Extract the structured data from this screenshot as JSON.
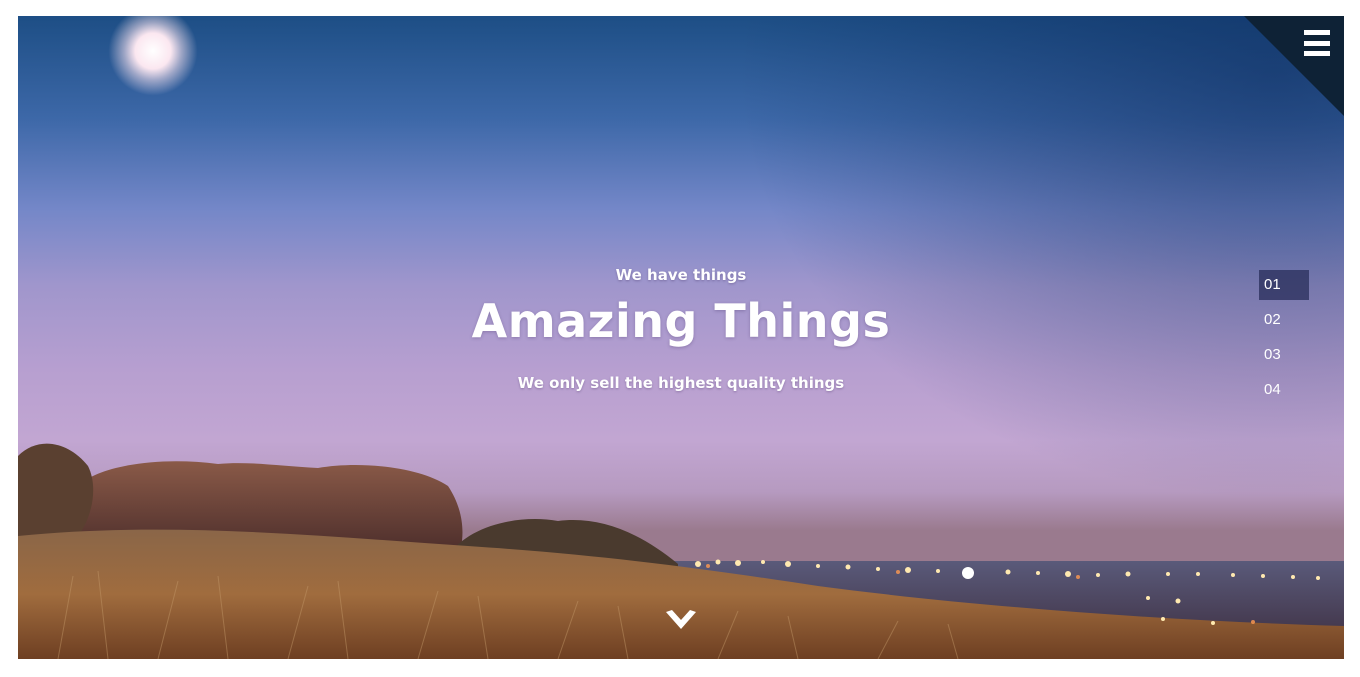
{
  "hero": {
    "eyebrow": "We have things",
    "headline": "Amazing Things",
    "tagline": "We only sell the highest quality things"
  },
  "menu": {
    "icon": "hamburger-menu-icon"
  },
  "slide_nav": {
    "items": [
      {
        "label": "01",
        "active": true
      },
      {
        "label": "02",
        "active": false
      },
      {
        "label": "03",
        "active": false
      },
      {
        "label": "04",
        "active": false
      }
    ]
  },
  "scroll": {
    "icon": "chevron-down-icon"
  },
  "colors": {
    "sky_top": "#1d4e85",
    "sky_mid": "#a096cc",
    "horizon": "#c2a6d2",
    "active_nav_bg": "#2e3468",
    "text": "#ffffff"
  }
}
